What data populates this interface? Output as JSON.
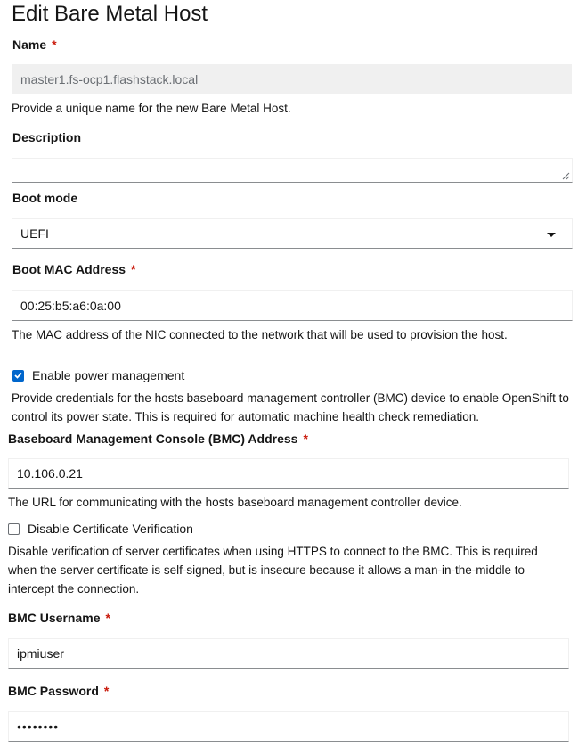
{
  "page": {
    "title": "Edit Bare Metal Host"
  },
  "fields": {
    "name": {
      "label": "Name",
      "required_mark": "*",
      "value": "master1.fs-ocp1.flashstack.local",
      "help": "Provide a unique name for the new Bare Metal Host."
    },
    "description": {
      "label": "Description",
      "value": ""
    },
    "boot_mode": {
      "label": "Boot mode",
      "selected": "UEFI",
      "icon": "caret-down-icon"
    },
    "boot_mac": {
      "label": "Boot MAC Address",
      "required_mark": "*",
      "value": "00:25:b5:a6:0a:00",
      "help": "The MAC address of the NIC connected to the network that will be used to provision the host."
    },
    "power_management": {
      "label": "Enable power management",
      "checked": true,
      "help": "Provide credentials for the hosts baseboard management controller (BMC) device to enable OpenShift to control its power state. This is required for automatic machine health check remediation."
    },
    "bmc_address": {
      "label": "Baseboard Management Console (BMC) Address",
      "required_mark": "*",
      "value": "10.106.0.21",
      "help": "The URL for communicating with the hosts baseboard management controller device."
    },
    "disable_cert": {
      "label": "Disable Certificate Verification",
      "checked": false,
      "help": "Disable verification of server certificates when using HTTPS to connect to the BMC. This is required when the server certificate is self-signed, but is insecure because it allows a man-in-the-middle to intercept the connection."
    },
    "bmc_username": {
      "label": "BMC Username",
      "required_mark": "*",
      "value": "ipmiuser"
    },
    "bmc_password": {
      "label": "BMC Password",
      "required_mark": "*",
      "value": "••••••••"
    }
  },
  "colors": {
    "required": "#c9190b",
    "checkbox_checked": "#0066cc",
    "disabled_bg": "#f0f0f0"
  }
}
